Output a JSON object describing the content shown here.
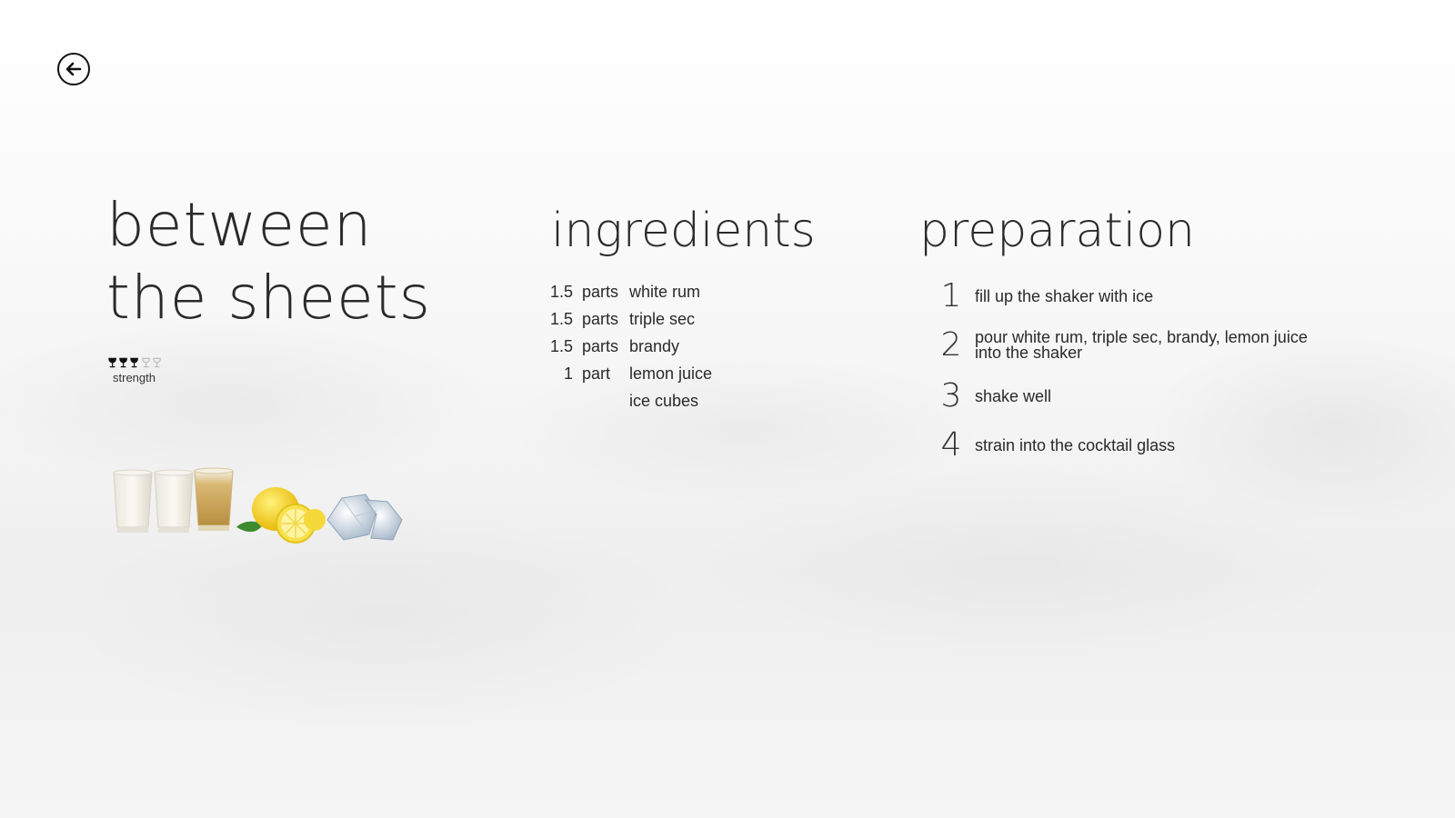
{
  "navigation": {
    "back_icon": "arrow-left-circle-icon"
  },
  "recipe": {
    "title_line_1": "between",
    "title_line_2": "the sheets",
    "strength": {
      "level": 3,
      "max": 5,
      "label": "strength",
      "icon": "cocktail-glass-icon",
      "active_color": "#111111",
      "inactive_color": "#bdbdbd"
    }
  },
  "ingredients": {
    "heading": "ingredients",
    "items": [
      {
        "qty": "1.5",
        "unit": "parts",
        "name": "white rum"
      },
      {
        "qty": "1.5",
        "unit": "parts",
        "name": "triple sec"
      },
      {
        "qty": "1.5",
        "unit": "parts",
        "name": "brandy"
      },
      {
        "qty": "1",
        "unit": "part",
        "name": "lemon juice"
      },
      {
        "qty": "",
        "unit": "",
        "name": "ice cubes"
      }
    ]
  },
  "preparation": {
    "heading": "preparation",
    "steps": [
      {
        "number": "1",
        "text": "fill up the shaker with ice"
      },
      {
        "number": "2",
        "text_line_1": "pour white rum, triple sec, brandy, lemon juice",
        "text_line_2": "into the shaker"
      },
      {
        "number": "3",
        "text": "shake well"
      },
      {
        "number": "4",
        "text": "strain into the cocktail glass"
      }
    ]
  },
  "image": {
    "depicts": [
      "shot-glass-icon",
      "shot-glass-icon",
      "shot-glass-icon",
      "lemon-icon",
      "ice-cubes-icon"
    ]
  }
}
